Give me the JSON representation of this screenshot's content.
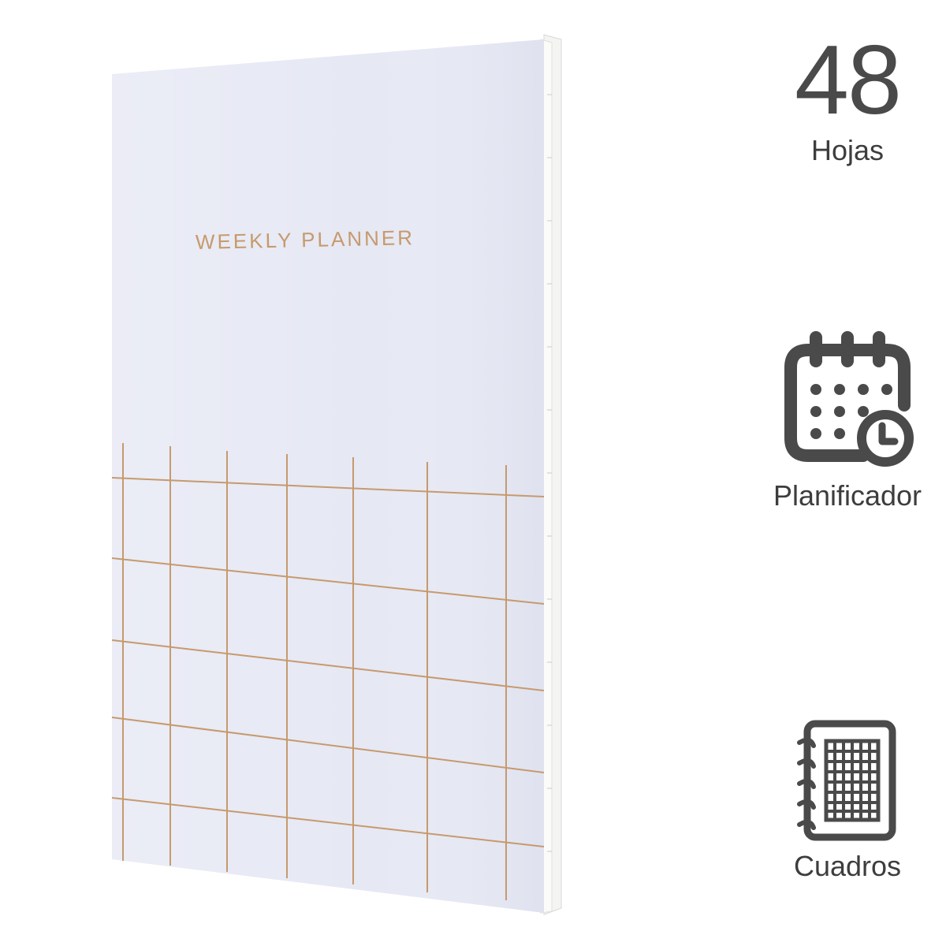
{
  "product": {
    "cover_title": "WEEKLY PLANNER",
    "cover_color": "#e6e8f4",
    "foil_color": "#c69a6d"
  },
  "features": {
    "sheets": {
      "value": "48",
      "label": "Hojas"
    },
    "planner": {
      "label": "Planificador",
      "icon": "calendar-clock-icon"
    },
    "grid": {
      "label": "Cuadros",
      "icon": "grid-notebook-icon"
    }
  },
  "colors": {
    "icon": "#4a4a4a",
    "text": "#3d3d3d"
  }
}
